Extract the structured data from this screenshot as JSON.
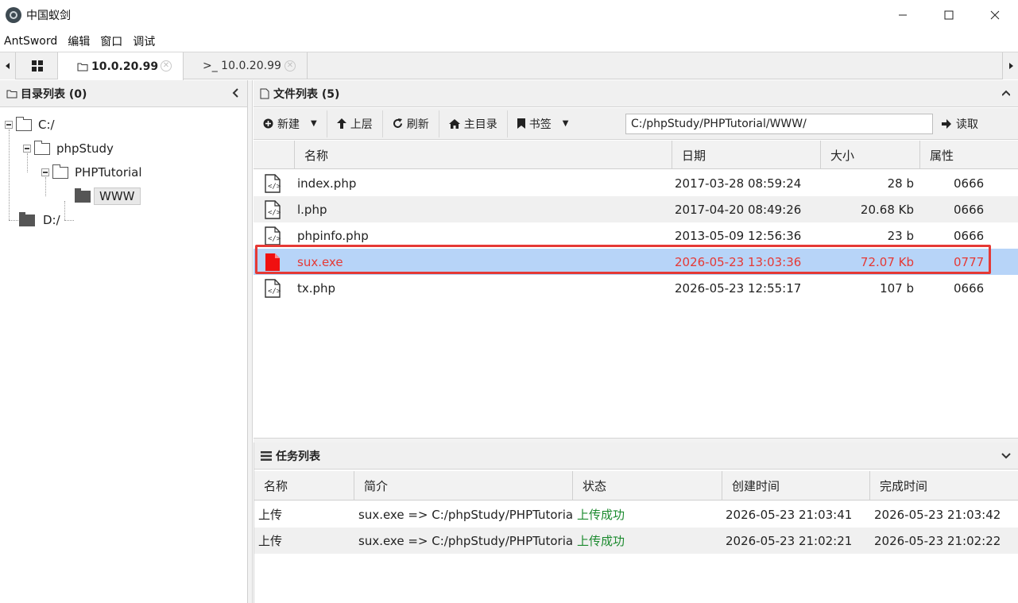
{
  "window": {
    "title": "中国蚁剑"
  },
  "menu": [
    "AntSword",
    "编辑",
    "窗口",
    "调试"
  ],
  "tabs": [
    {
      "label": "10.0.20.99",
      "icon": "folder-icon"
    },
    {
      "label": ">_ 10.0.20.99",
      "icon": "terminal-icon"
    }
  ],
  "left_panel": {
    "title": "目录列表 (0)",
    "tree": [
      {
        "label": "C:/"
      },
      {
        "label": "phpStudy"
      },
      {
        "label": "PHPTutorial"
      },
      {
        "label": "WWW"
      },
      {
        "label": "D:/"
      }
    ]
  },
  "file_panel": {
    "title": "文件列表 (5)",
    "toolbar": {
      "new_label": "新建",
      "up_label": "上层",
      "refresh_label": "刷新",
      "home_label": "主目录",
      "bookmark_label": "书签",
      "path_value": "C:/phpStudy/PHPTutorial/WWW/",
      "read_label": "读取"
    },
    "columns": [
      "名称",
      "日期",
      "大小",
      "属性"
    ],
    "files": [
      {
        "name": "index.php",
        "date": "2017-03-28 08:59:24",
        "size": "28 b",
        "attr": "0666",
        "icon": "php-file-icon"
      },
      {
        "name": "l.php",
        "date": "2017-04-20 08:49:26",
        "size": "20.68 Kb",
        "attr": "0666",
        "icon": "php-file-icon"
      },
      {
        "name": "phpinfo.php",
        "date": "2013-05-09 12:56:36",
        "size": "23 b",
        "attr": "0666",
        "icon": "php-file-icon"
      },
      {
        "name": "sux.exe",
        "date": "2026-05-23 13:03:36",
        "size": "72.07 Kb",
        "attr": "0777",
        "icon": "exe-file-icon"
      },
      {
        "name": "tx.php",
        "date": "2026-05-23 12:55:17",
        "size": "107 b",
        "attr": "0666",
        "icon": "php-file-icon"
      }
    ]
  },
  "task_panel": {
    "title": "任务列表",
    "columns": [
      "名称",
      "简介",
      "状态",
      "创建时间",
      "完成时间"
    ],
    "tasks": [
      {
        "name": "上传",
        "desc": "sux.exe => C:/phpStudy/PHPTutorial/",
        "status": "上传成功",
        "created": "2026-05-23 21:03:41",
        "finished": "2026-05-23 21:03:42"
      },
      {
        "name": "上传",
        "desc": "sux.exe => C:/phpStudy/PHPTutorial/",
        "status": "上传成功",
        "created": "2026-05-23 21:02:21",
        "finished": "2026-05-23 21:02:22"
      }
    ]
  },
  "colors": {
    "selected_row": "#b7d4f8",
    "highlight": "#e53935",
    "success": "#1b8a2e"
  }
}
